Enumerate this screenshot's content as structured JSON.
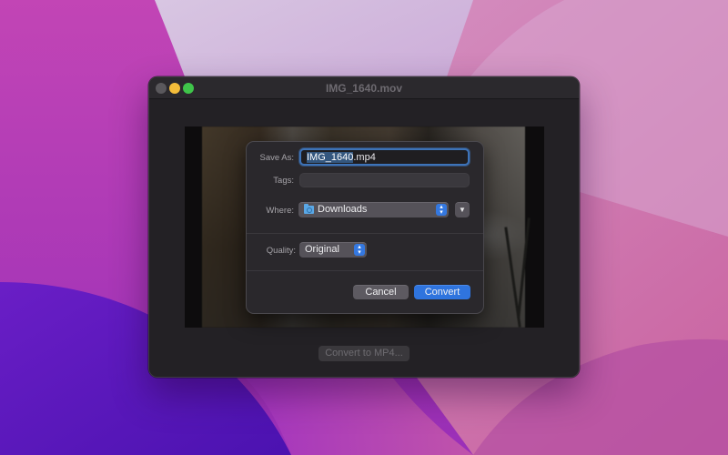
{
  "window": {
    "title": "IMG_1640.mov",
    "traffic_lights": [
      "close",
      "minimize",
      "zoom"
    ]
  },
  "dialog": {
    "save_as": {
      "label": "Save As:",
      "value_selected": "IMG_1640",
      "value_rest": ".mp4"
    },
    "tags": {
      "label": "Tags:",
      "value": ""
    },
    "where": {
      "label": "Where:",
      "value": "Downloads",
      "folder_icon": "folder-icon",
      "expand_glyph": "⌄"
    },
    "quality": {
      "label": "Quality:",
      "value": "Original"
    },
    "stepper_glyph": "⌃⌄",
    "buttons": {
      "cancel": "Cancel",
      "convert": "Convert"
    }
  },
  "footer": {
    "convert_button": "Convert to MP4..."
  },
  "colors": {
    "accent": "#2f74de",
    "focus_ring": "#3d73b8",
    "window_bg": "#232125",
    "sheet_bg": "#2a282c"
  }
}
